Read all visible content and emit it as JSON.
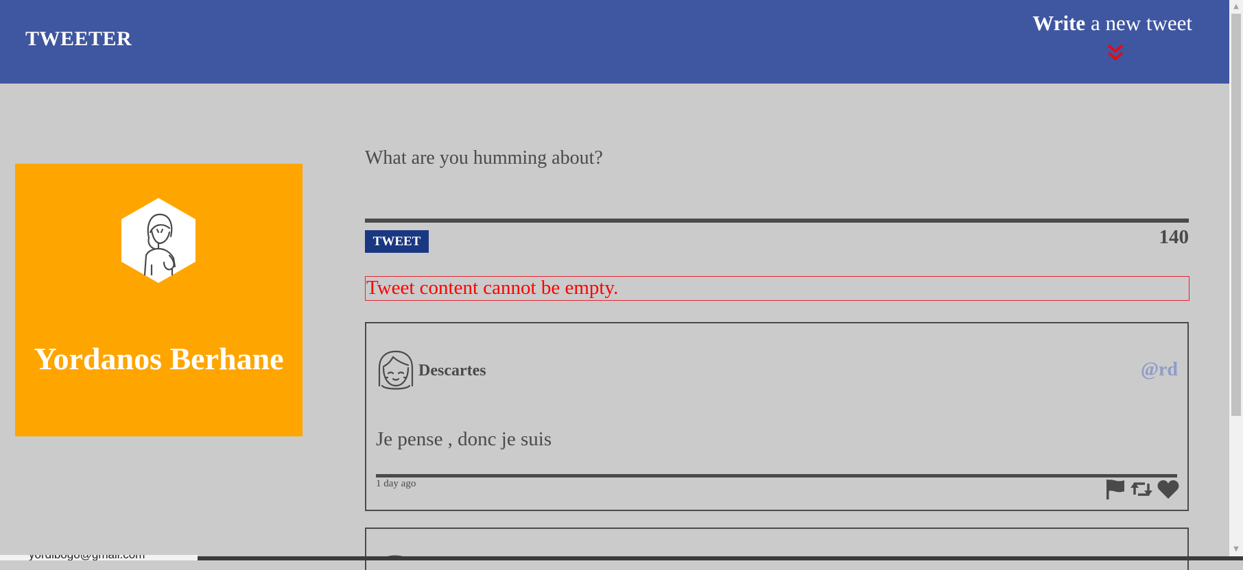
{
  "header": {
    "brand": "TWEETER",
    "compose_bold": "Write",
    "compose_rest": " a new tweet",
    "toggle_icon": "double-chevron-down-icon",
    "toggle_icon_color": "#ff0000",
    "background": "#3f56a0"
  },
  "profile": {
    "name": "Yordanos Berhane",
    "avatar_icon": "user-avatar-icon",
    "background": "#ffa500"
  },
  "compose": {
    "placeholder": "What are you humming about?",
    "value": "",
    "button_label": "TWEET",
    "counter": "140",
    "error": "Tweet content cannot be empty."
  },
  "tweets": [
    {
      "author": "Descartes",
      "handle": "@rd",
      "content": "Je pense , donc je suis",
      "time": "1 day ago",
      "actions": [
        "flag-icon",
        "retweet-icon",
        "heart-icon"
      ]
    }
  ],
  "bottom_bar": {
    "text": "yordibogo@gmail.com"
  }
}
